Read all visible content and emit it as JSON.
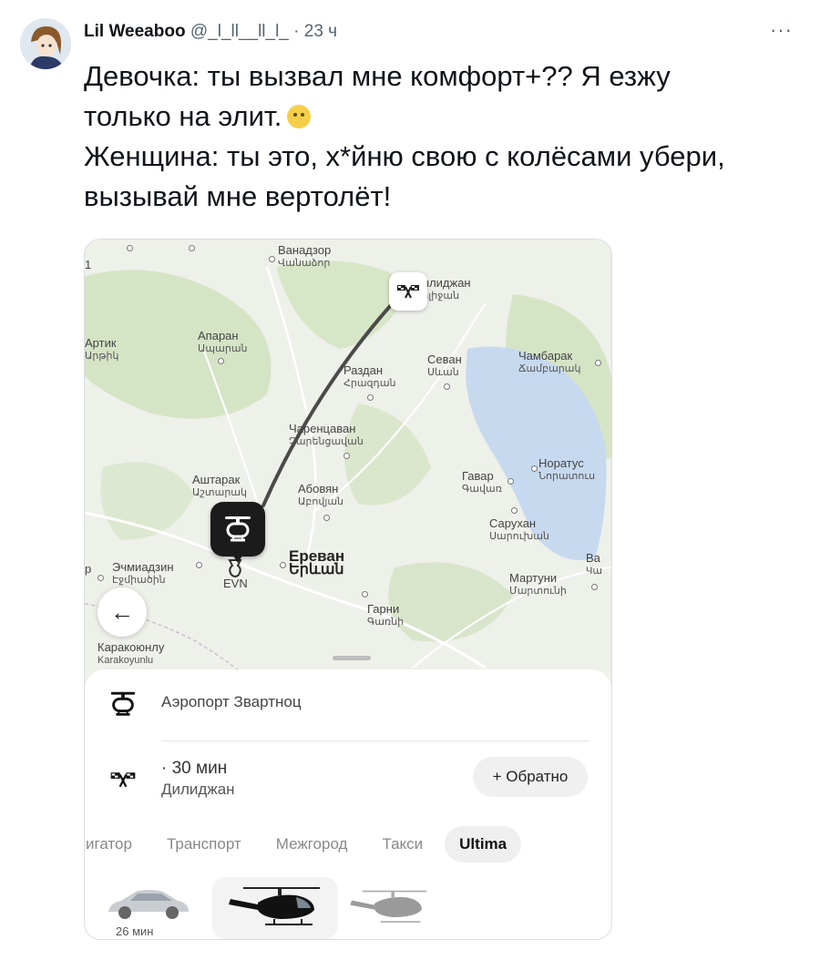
{
  "tweet": {
    "author_name": "Lil Weeaboo",
    "handle": "@_l_ll__ll_l_",
    "separator": "·",
    "time": "23 ч",
    "more_icon": "more-dots-icon",
    "lines": [
      "Девочка: ты вызвал мне комфорт+?? Я езжу",
      "только на элит.",
      "Женщина: ты это, х*йню свою с колёсами убери,",
      "вызывай мне вертолёт!"
    ]
  },
  "map": {
    "labels": {
      "vanadzor": {
        "ru": "Ванадзор",
        "hy": "Վանաձոր"
      },
      "dilijan": {
        "ru": "Дилиджан",
        "hy": "Դիլիջան"
      },
      "artik": {
        "ru": "Артик",
        "hy": "Արթիկ"
      },
      "aparan": {
        "ru": "Апаран",
        "hy": "Ապարան"
      },
      "razdan": {
        "ru": "Раздан",
        "hy": "Հրազդան"
      },
      "sevan": {
        "ru": "Севан",
        "hy": "Սևան"
      },
      "chambarak": {
        "ru": "Чамбарак",
        "hy": "Ճամբարակ"
      },
      "charentsavan": {
        "ru": "Чаренцаван",
        "hy": "Չարենցավան"
      },
      "noratus": {
        "ru": "Норатус",
        "hy": "Նորատուս"
      },
      "ashtarak": {
        "ru": "Аштарак",
        "hy": "Աշտարակ"
      },
      "abovyan": {
        "ru": "Абовян",
        "hy": "Աբովյան"
      },
      "gavar": {
        "ru": "Гавар",
        "hy": "Գավառ"
      },
      "sarukhan": {
        "ru": "Сарухан",
        "hy": "Սարուխան"
      },
      "echmiadzin": {
        "ru": "Эчмиадзин",
        "hy": "Էջմիածին"
      },
      "yerevan": {
        "ru": "Ереван",
        "hy": "Երևան"
      },
      "martuni": {
        "ru": "Мартуни",
        "hy": "Մարտունի"
      },
      "garni": {
        "ru": "Гарни",
        "hy": "Գառնի"
      },
      "karakoyunlu": {
        "ru": "Каракоюнлу",
        "en": "Karakoyunlu"
      },
      "evn": "EVN",
      "edge_p": "р",
      "edge_v": "Ва",
      "edge_ch": "Чա"
    },
    "back_icon": "←"
  },
  "sheet": {
    "from": "Аэропорт Звартноц",
    "eta": "· 30 мин",
    "to": "Дилиджан",
    "back_trip_label": "+ Обратно",
    "tabs": [
      "вигатор",
      "Транспорт",
      "Межгород",
      "Такси",
      "Ultima"
    ],
    "active_tab": "Ultima",
    "vehicle_time": "26 мин"
  },
  "colors": {
    "map_land": "#eef0ea",
    "map_green": "#d6e4c6",
    "water": "#c7d9ef",
    "route": "#4a4a4a",
    "pin_dark": "#1b1b1b"
  }
}
